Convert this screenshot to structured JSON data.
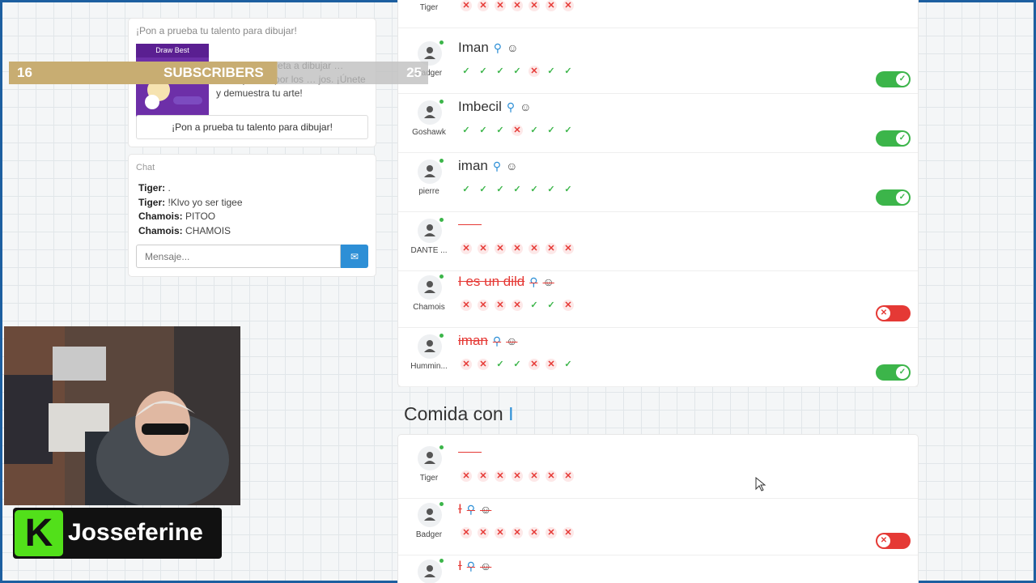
{
  "promo": {
    "title": "¡Pon a prueba tu talento para dibujar!",
    "badge": "Draw Best",
    "description": "Draw Best te reta a dibujar … rtidas y votar por los … jos. ¡Únete y demuestra tu arte!",
    "cta": "¡Pon a prueba tu talento para dibujar!"
  },
  "chat": {
    "title": "Chat",
    "messages": [
      {
        "user": "Tiger:",
        "text": " ."
      },
      {
        "user": "Tiger:",
        "text": " !Klvo yo ser tigee"
      },
      {
        "user": "Chamois:",
        "text": " PITOO"
      },
      {
        "user": "Chamois:",
        "text": " CHAMOIS"
      }
    ],
    "placeholder": "Mensaje..."
  },
  "overlay": {
    "left": "16",
    "label": "SUBSCRIBERS",
    "right": "25"
  },
  "brand": {
    "letter": "K",
    "name": "Josseferine"
  },
  "category": {
    "prefix": "Comida con ",
    "letter": "I"
  },
  "board1": [
    {
      "player": "Tiger",
      "word": "",
      "votes": [
        "n",
        "n",
        "n",
        "n",
        "n",
        "n",
        "n"
      ],
      "toggle": null
    },
    {
      "player": "Badger",
      "word": "Iman",
      "votes": [
        "y",
        "y",
        "y",
        "y",
        "n",
        "y",
        "y"
      ],
      "toggle": "on"
    },
    {
      "player": "Goshawk",
      "word": "Imbecil",
      "votes": [
        "y",
        "y",
        "y",
        "n",
        "y",
        "y",
        "y"
      ],
      "toggle": "on"
    },
    {
      "player": "pierre",
      "word": "iman",
      "votes": [
        "y",
        "y",
        "y",
        "y",
        "y",
        "y",
        "y"
      ],
      "toggle": "on"
    },
    {
      "player": "DANTE ...",
      "word": "",
      "votes": [
        "n",
        "n",
        "n",
        "n",
        "n",
        "n",
        "n"
      ],
      "toggle": null
    },
    {
      "player": "Chamois",
      "word": "I es un dild",
      "bad": true,
      "votes": [
        "n",
        "n",
        "n",
        "n",
        "y",
        "y",
        "n"
      ],
      "toggle": "off"
    },
    {
      "player": "Hummin...",
      "word": "iman",
      "bad": true,
      "votes": [
        "n",
        "n",
        "y",
        "y",
        "n",
        "n",
        "y"
      ],
      "toggle": "on"
    }
  ],
  "board2": [
    {
      "player": "Tiger",
      "word": "",
      "votes": [
        "n",
        "n",
        "n",
        "n",
        "n",
        "n",
        "n"
      ],
      "toggle": null
    },
    {
      "player": "Badger",
      "word": "I",
      "bad": true,
      "votes": [
        "n",
        "n",
        "n",
        "n",
        "n",
        "n",
        "n"
      ],
      "toggle": "off"
    },
    {
      "player": "",
      "word": "I",
      "bad": true,
      "votes": [],
      "toggle": null
    }
  ]
}
